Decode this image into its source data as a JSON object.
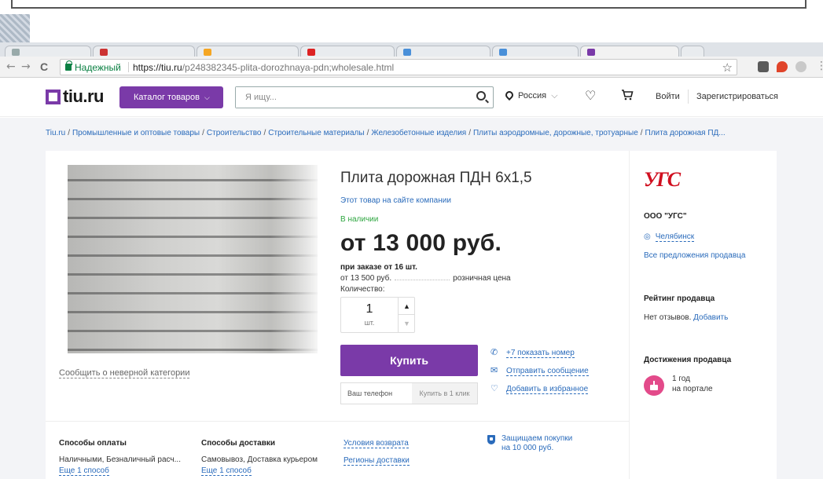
{
  "browser": {
    "secure_label": "Надежный",
    "url_host": "https://tiu.ru",
    "url_path": "/p248382345-plita-dorozhnaya-pdn;wholesale.html",
    "nav_back": "←",
    "nav_forward": "→",
    "nav_reload": "C",
    "bookmark_icon": "star-icon",
    "star_glyph": "☆",
    "extension_colors": [
      "#5a5a5a",
      "#e0442a",
      "#c9c9c9"
    ]
  },
  "header": {
    "logo_text": "tiu.ru",
    "catalog_label": "Каталог товаров",
    "catalog_chevron": "⌵",
    "search_placeholder": "Я ищу...",
    "region_label": "Россия",
    "region_chevron": "⌵",
    "favorites_glyph": "♡",
    "cart_glyph": "🛒",
    "login_label": "Войти",
    "register_label": "Зарегистрироваться",
    "accent_color": "#7a3aa8"
  },
  "breadcrumbs": [
    "Tiu.ru",
    "Промышленные и оптовые товары",
    "Строительство",
    "Строительные материалы",
    "Железобетонные изделия",
    "Плиты аэродромные, дорожные, тротуарные",
    "Плита дорожная ПД..."
  ],
  "product": {
    "title": "Плита дорожная ПДН 6х1,5",
    "company_link": "Этот товар на сайте компании",
    "availability": "В наличии",
    "price": "от 13 000 руб.",
    "price_condition": "при заказе от 16 шт.",
    "retail_price": "от 13 500 руб.",
    "retail_label": "розничная цена",
    "quantity_label": "Количество:",
    "quantity_value": "1",
    "quantity_unit": "шт.",
    "qty_up_glyph": "▲",
    "qty_down_glyph": "▼",
    "buy_label": "Купить",
    "phone_placeholder": "Ваш телефон",
    "one_click_label": "Купить в 1 клик",
    "report_label": "Сообщить о неверной категории"
  },
  "actions": {
    "phone": {
      "glyph": "✆",
      "label": "+7 показать номер"
    },
    "message": {
      "glyph": "✉",
      "label": "Отправить сообщение"
    },
    "favorite": {
      "glyph": "♡",
      "label": "Добавить в избранное"
    }
  },
  "seller": {
    "logo_text": "УГС",
    "name": "ООО \"УГС\"",
    "city_glyph": "◎",
    "city": "Челябинск",
    "all_offers": "Все предложения продавца",
    "rating_heading": "Рейтинг продавца",
    "rating_text": "Нет отзывов.",
    "rating_link": "Добавить",
    "achievements_heading": "Достижения продавца",
    "achievement_line1": "1 год",
    "achievement_line2": "на портале"
  },
  "info": {
    "payment_heading": "Способы оплаты",
    "payment_text": "Наличными, Безналичный расч...",
    "payment_more": "Еще 1 способ",
    "delivery_heading": "Способы доставки",
    "delivery_text": "Самовывоз, Доставка курьером",
    "delivery_more": "Еще 1 способ",
    "returns_link": "Условия возврата",
    "regions_link": "Регионы доставки",
    "protection_line1": "Защищаем покупки",
    "protection_line2": "на 10 000 руб."
  }
}
